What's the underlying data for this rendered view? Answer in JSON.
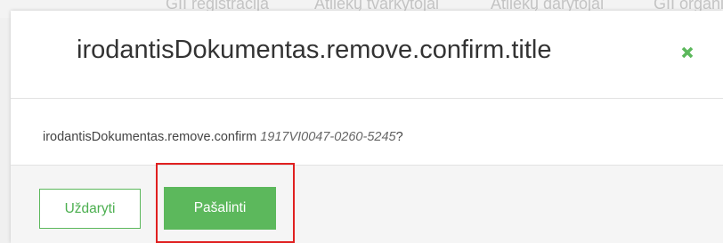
{
  "background_nav": {
    "tabs": [
      "GII registracija",
      "Atliekų tvarkytojai",
      "Atliekų darytojai",
      "GII organizatoriai"
    ]
  },
  "modal": {
    "title": "irodantisDokumentas.remove.confirm.title",
    "close_icon": "close-icon",
    "body": {
      "confirm_message": "irodantisDokumentas.remove.confirm",
      "document_number": "1917VI0047-0260-5245",
      "suffix": "?"
    },
    "footer": {
      "close_label": "Uždaryti",
      "remove_label": "Pašalinti"
    }
  },
  "colors": {
    "accent_green": "#5cb85c",
    "highlight_red": "#e02020",
    "close_icon_green": "#5cb85c"
  }
}
